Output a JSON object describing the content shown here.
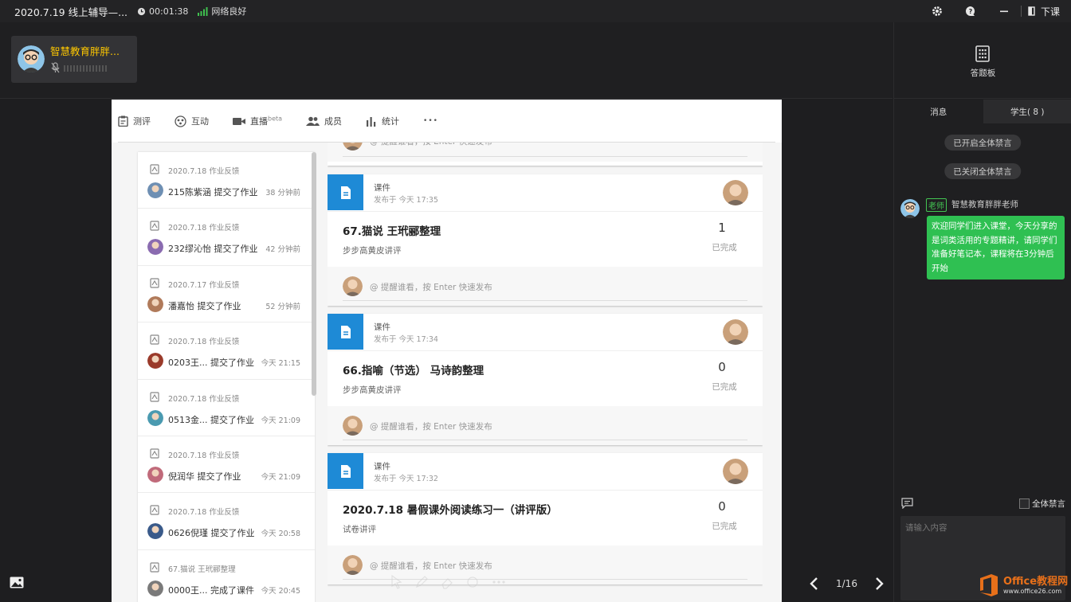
{
  "titlebar": {
    "title": "2020.7.19 线上辅导—...",
    "timer": "00:01:38",
    "network": "网络良好",
    "exit_label": "下课"
  },
  "video": {
    "name": "智慧教育胖胖..."
  },
  "nav": {
    "items": [
      {
        "label": "测评"
      },
      {
        "label": "互动"
      },
      {
        "label": "直播",
        "sup": "beta"
      },
      {
        "label": "成员"
      },
      {
        "label": "统计"
      }
    ],
    "more": "•••"
  },
  "activity": [
    {
      "head": "2020.7.18 作业反馈",
      "text": "215陈紫涵 提交了作业",
      "time": "38 分钟前"
    },
    {
      "head": "2020.7.18 作业反馈",
      "text": "232缪沁怡 提交了作业",
      "time": "42 分钟前"
    },
    {
      "head": "2020.7.17 作业反馈",
      "text": "潘嘉怡 提交了作业",
      "time": "52 分钟前"
    },
    {
      "head": "2020.7.18 作业反馈",
      "text": "0203王...      提交了作业",
      "time": "今天 21:15"
    },
    {
      "head": "2020.7.18 作业反馈",
      "text": "0513金...      提交了作业",
      "time": "今天 21:09"
    },
    {
      "head": "2020.7.18 作业反馈",
      "text": "倪润华 提交了作业",
      "time": "今天 21:09"
    },
    {
      "head": "2020.7.18 作业反馈",
      "text": "0626倪瑾 提交了作业",
      "time": "今天 20:58"
    },
    {
      "head": "67.猫说 王玳郦整理",
      "text": "0000王...      完成了课件",
      "time": "今天 20:45"
    }
  ],
  "feed": {
    "reply_placeholder": "@ 提醒谁看，按 Enter 快速发布",
    "cards": [
      {
        "type": "课件",
        "date": "发布于 今天 17:35",
        "title": "67.猫说 王玳郦整理",
        "sub": "步步高黄皮讲评",
        "count": "1",
        "done": "已完成"
      },
      {
        "type": "课件",
        "date": "发布于 今天 17:34",
        "title": "66.指喻（节选） 马诗韵整理",
        "sub": "步步高黄皮讲评",
        "count": "0",
        "done": "已完成"
      },
      {
        "type": "课件",
        "date": "发布于 今天 17:32",
        "title": "2020.7.18 暑假课外阅读练习一（讲评版）",
        "sub": "试卷讲评",
        "count": "0",
        "done": "已完成"
      }
    ]
  },
  "pager": {
    "page": "1/16"
  },
  "sidebar": {
    "answer_board": "答题板",
    "tabs": [
      "消息",
      "学生( 8 )"
    ],
    "notices": [
      "已开启全体禁言",
      "已关闭全体禁言"
    ],
    "message": {
      "tag": "老师",
      "name": "智慧教育胖胖老师",
      "text": "欢迎同学们进入课堂，今天分享的是词类活用的专题精讲，请同学们准备好笔记本，课程将在3分钟后开始"
    },
    "mute_all": "全体禁言",
    "input_placeholder": "请输入内容"
  },
  "watermark": {
    "title": "Office教程网",
    "url": "www.office26.com"
  },
  "colors": {
    "accent_blue": "#1e8ad6",
    "bubble_green": "#2fc052",
    "name_yellow": "#ffc800"
  }
}
